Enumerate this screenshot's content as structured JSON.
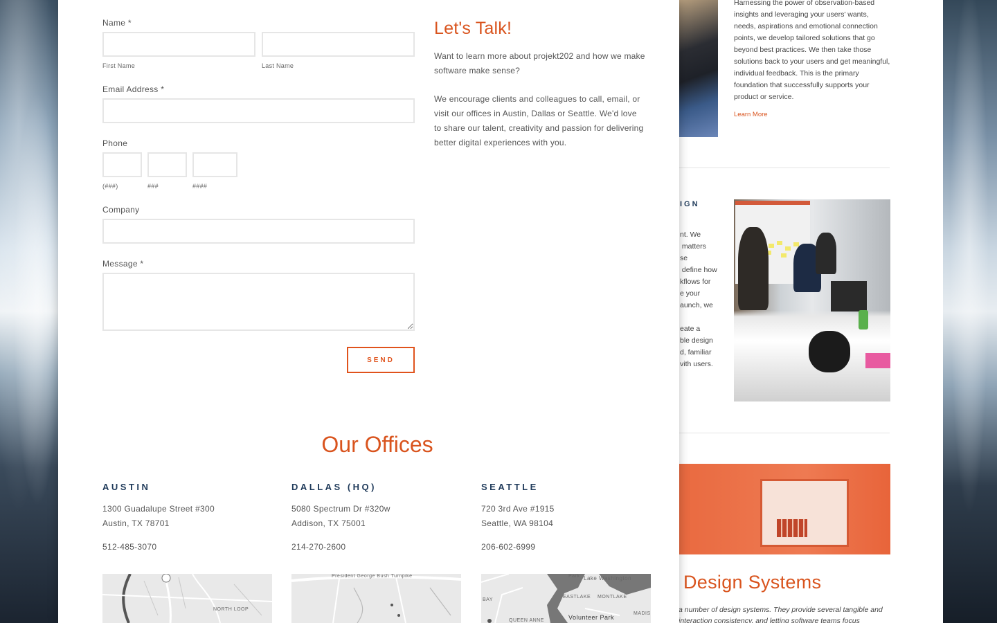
{
  "form": {
    "name_label": "Name *",
    "first_name_caption": "First Name",
    "last_name_caption": "Last Name",
    "email_label": "Email Address *",
    "phone_label": "Phone",
    "phone_area_caption": "(###)",
    "phone_prefix_caption": "###",
    "phone_line_caption": "####",
    "company_label": "Company",
    "message_label": "Message *",
    "send_label": "SEND"
  },
  "talk": {
    "title": "Let's Talk!",
    "paragraph1": "Want to learn more about projekt202 and how we make software make sense?",
    "paragraph2": "We encourage clients and colleagues to call, email, or visit our offices in Austin, Dallas or Seattle. We'd love to share our talent, creativity and passion for delivering better digital experiences with you."
  },
  "offices": {
    "title": "Our Offices",
    "list": [
      {
        "city": "AUSTIN",
        "address1": "1300 Guadalupe Street #300",
        "address2": "Austin, TX 78701",
        "phone": "512-485-3070",
        "map_labels": [
          "NORTH LOOP"
        ]
      },
      {
        "city": "DALLAS (HQ)",
        "address1": "5080 Spectrum Dr #320w",
        "address2": "Addison, TX 75001",
        "phone": "214-270-2600",
        "map_labels": [
          "President George Bush Turnpike"
        ]
      },
      {
        "city": "SEATTLE",
        "address1": "720 3rd Ave #1915",
        "address2": "Seattle, WA 98104",
        "phone": "206-602-6999",
        "map_labels": [
          "Lake Washington",
          "Park",
          "EASTLAKE",
          "MONTLAKE",
          "QUEEN ANNE",
          "Volunteer Park",
          "MADIS",
          "BAY"
        ]
      }
    ]
  },
  "background_page": {
    "intro_text": "Harnessing the power of observation-based insights and leveraging your users' wants, needs, aspirations and emotional connection points, we develop tailored solutions that go beyond best practices. We then take those solutions back to your users and get meaningful, individual feedback. This is the primary foundation that successfully supports your product or service.",
    "learn_more": "Learn More",
    "heading_fragment": "IGN",
    "fragment_lines": "nt. We\n matters\nse\n define how\nkflows for\ne your\naunch, we\n\neate a\nble design\nd, familiar\nvith users.",
    "design_systems_title": "Design Systems",
    "design_systems_text": "a number of design systems. They provide several tangible and interaction consistency, and letting software teams focus"
  },
  "colors": {
    "accent": "#d9541e",
    "city_heading": "#1f3a5a",
    "text": "#555555"
  }
}
